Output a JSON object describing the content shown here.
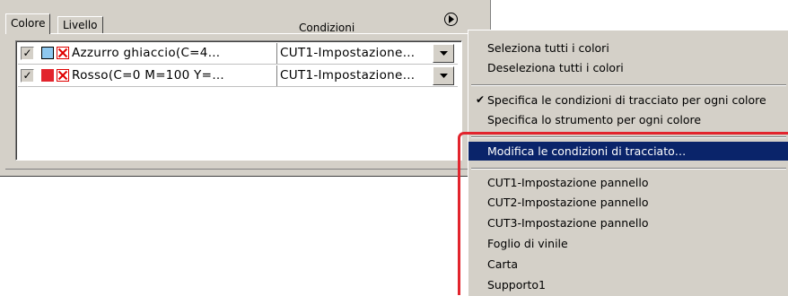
{
  "tabs": [
    {
      "label": "Colore",
      "active": true
    },
    {
      "label": "Livello",
      "active": false
    }
  ],
  "header": {
    "conditions_label": "Condizioni",
    "menu_button_icon": "circle-arrow-right-icon"
  },
  "rows": [
    {
      "checked": true,
      "swatch_color": "#8ec8f0",
      "name": "Azzurro  ghiaccio(C=4…",
      "condition": "CUT1-Impostazione…"
    },
    {
      "checked": true,
      "swatch_color": "#e2242d",
      "name": "Rosso(C=0  M=100  Y=…",
      "condition": "CUT1-Impostazione…"
    }
  ],
  "menu": {
    "items": [
      {
        "label": "Seleziona tutti i colori"
      },
      {
        "label": "Deseleziona tutti i colori"
      },
      {
        "label": "Specifica le condizioni di tracciato per ogni colore",
        "checked": true
      },
      {
        "label": "Specifica lo strumento per ogni colore"
      },
      {
        "label": "Modifica le condizioni di tracciato…",
        "highlighted": true
      },
      {
        "label": "CUT1-Impostazione pannello"
      },
      {
        "label": "CUT2-Impostazione pannello"
      },
      {
        "label": "CUT3-Impostazione pannello"
      },
      {
        "label": "Foglio di vinile"
      },
      {
        "label": "Carta"
      },
      {
        "label": "Supporto1"
      }
    ],
    "check_glyph": "✔"
  },
  "colors": {
    "highlight": "#0a246a",
    "callout_border": "#e2242d",
    "panel_bg": "#d4d0c8"
  }
}
